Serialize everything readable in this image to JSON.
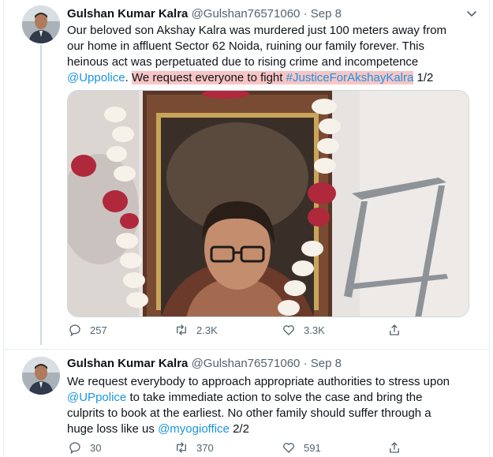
{
  "colors": {
    "link": "#1b95e0",
    "highlight": "#f7c5c5",
    "muted": "#536471"
  },
  "tweets": [
    {
      "author": {
        "name": "Gulshan Kumar Kalra",
        "handle": "@Gulshan76571060"
      },
      "separator": "·",
      "date": "Sep 8",
      "text": {
        "line1": "Our beloved son Akshay Kalra was murdered just 100 meters away from",
        "line2": "our home in affluent Sector 62 Noida, ruining our family forever. This",
        "line3": "heinous act was perpetuated due to rising crime and incompetence",
        "mention": "@Uppolice",
        "period": ".",
        "highlight_text": "We request everyone to fight",
        "hashtag": "#JusticeForAkshayKalra",
        "suffix": "1/2"
      },
      "media_icon": "memorial-photo-image",
      "stats": {
        "replies": "257",
        "retweets": "2.3K",
        "likes": "3.3K"
      }
    },
    {
      "author": {
        "name": "Gulshan Kumar Kalra",
        "handle": "@Gulshan76571060"
      },
      "separator": "·",
      "date": "Sep 8",
      "text": {
        "line1": "We request everybody to approach appropriate authorities to stress upon",
        "mention1": "@UPpolice",
        "line2_rest": "to take immediate action to solve the case and bring the",
        "line3": "culprits to book at the earliest. No other family should suffer through a",
        "line4_start": "huge loss like us",
        "mention2": "@myogioffice",
        "suffix": "2/2"
      },
      "stats": {
        "replies": "30",
        "retweets": "370",
        "likes": "591"
      }
    }
  ]
}
